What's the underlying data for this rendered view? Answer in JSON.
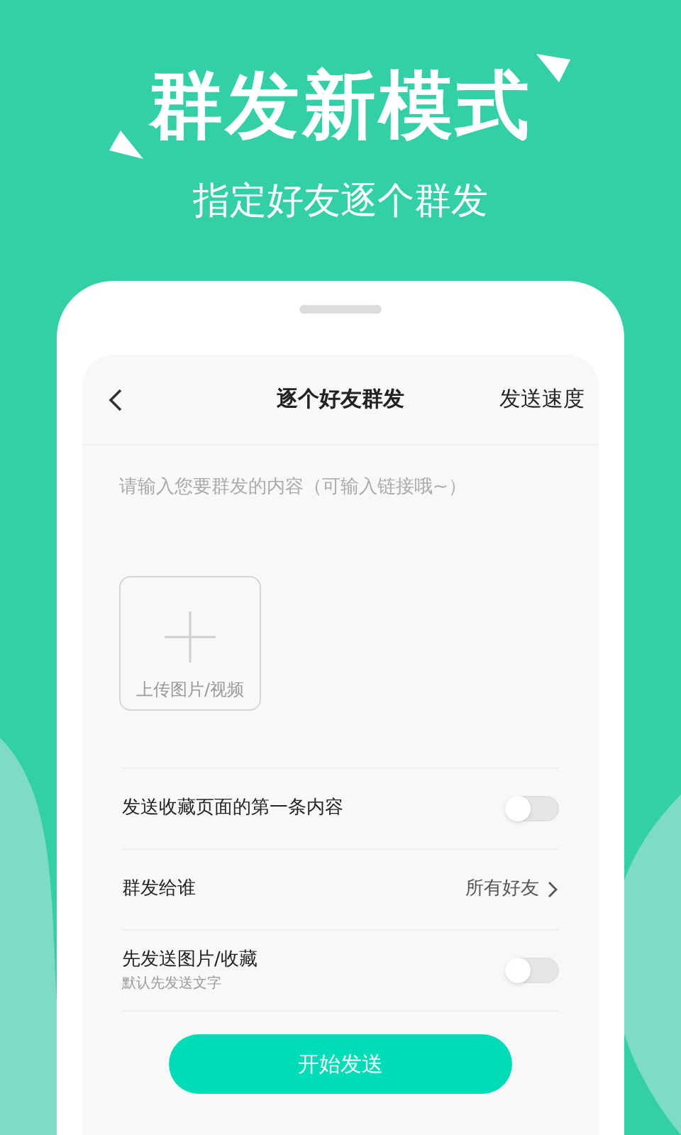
{
  "headline": "群发新模式",
  "subheadline": "指定好友逐个群发",
  "app": {
    "nav": {
      "title": "逐个好友群发",
      "action": "发送速度"
    },
    "message": {
      "placeholder": "请输入您要群发的内容（可输入链接哦~）"
    },
    "upload": {
      "label": "上传图片/视频"
    },
    "settings": [
      {
        "kind": "toggle",
        "label": "发送收藏页面的第一条内容",
        "on": false
      },
      {
        "kind": "link",
        "label": "群发给谁",
        "value": "所有好友"
      },
      {
        "kind": "toggle",
        "label": "先发送图片/收藏",
        "hint": "默认先发送文字",
        "on": false
      }
    ],
    "button": "开始发送"
  }
}
